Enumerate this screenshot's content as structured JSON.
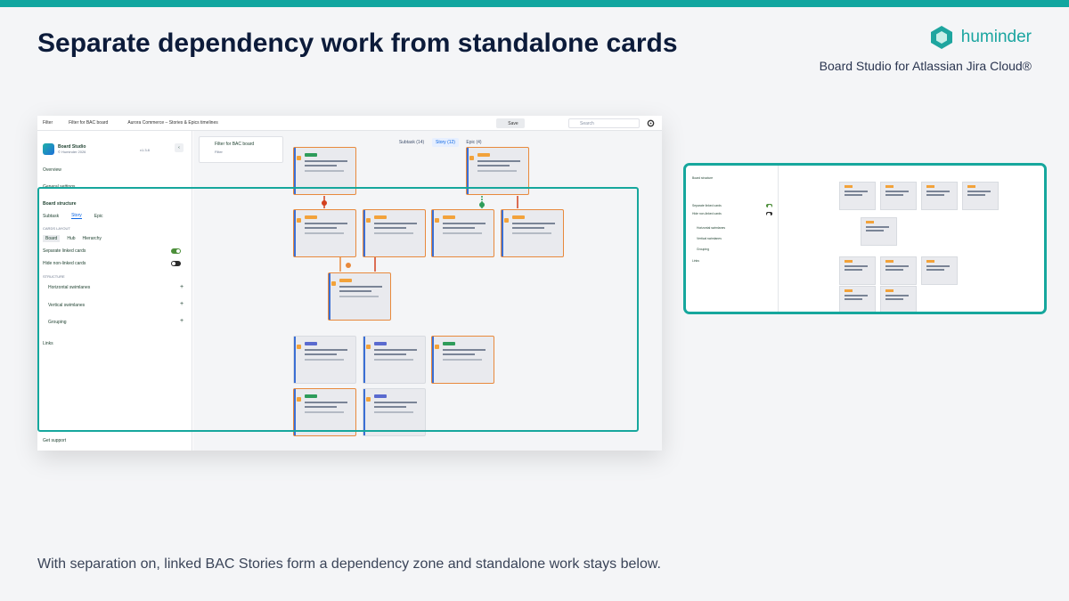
{
  "header": {
    "title": "Separate dependency work from standalone cards",
    "brand_name": "huminder",
    "subtitle": "Board Studio for Atlassian Jira Cloud®",
    "caption": "With separation on, linked BAC Stories form a dependency zone and standalone work stays below."
  },
  "app": {
    "topbar": {
      "filter_label": "Filter",
      "filter_name": "Filter for BAC board",
      "board_name": "Aurora Commerce – Stories & Epics timelines",
      "save_label": "Save",
      "search_placeholder": "Search"
    },
    "sidebar": {
      "app_title": "Board Studio",
      "app_sub": "© Huminder 2026",
      "version": "v1.3.8",
      "overview": "Overview",
      "general": "General settings",
      "board_structure": "Board structure",
      "tabs": [
        "Subtask",
        "Story",
        "Epic"
      ],
      "cards_layout_label": "CARDS LAYOUT",
      "layout_options": [
        "Board",
        "Hub",
        "Hierarchy"
      ],
      "separate_linked": "Separate linked cards",
      "hide_non_linked": "Hide non-linked cards",
      "structure_label": "STRUCTURE",
      "structure_items": [
        "Horizontal swimlanes",
        "Vertical swimlanes",
        "Grouping"
      ],
      "links": "Links",
      "support": "Get support"
    },
    "board": {
      "filter_card_title": "Filter for BAC board",
      "filter_card_sub": "Filter",
      "type_tabs": [
        "Subtask (14)",
        "Story (12)",
        "Epic (4)"
      ]
    }
  },
  "toggles": {
    "separate_linked": true,
    "hide_non_linked": false
  },
  "colors": {
    "accent": "#16a79d",
    "title": "#0c1b3a",
    "link_red": "#d3401f",
    "link_orange": "#e8893c",
    "link_green": "#2e9c5a"
  },
  "icons": [
    "logo-hexagon-icon",
    "filter-icon",
    "search-icon",
    "gear-icon",
    "chevron-left-icon",
    "plus-icon"
  ]
}
